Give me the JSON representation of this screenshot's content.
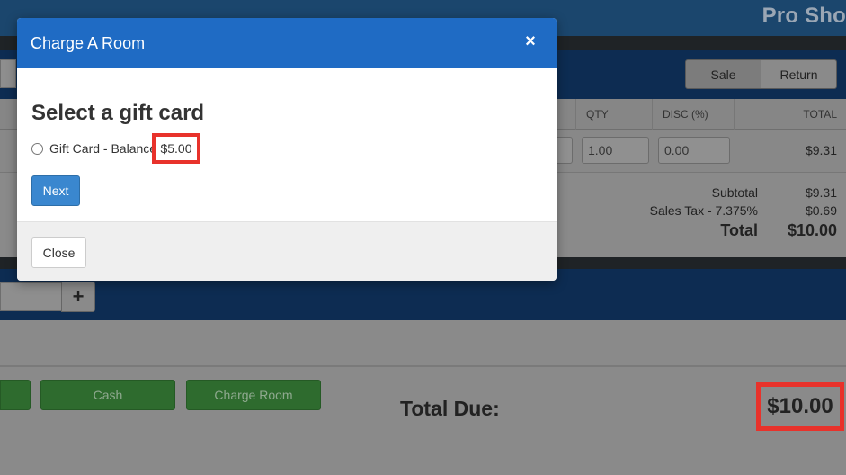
{
  "app": {
    "title": "Pro Sho"
  },
  "mode_toggle": {
    "sale_label": "Sale",
    "return_label": "Return"
  },
  "table": {
    "columns": [
      "QTY",
      "DISC (%)",
      "TOTAL"
    ],
    "rows": [
      {
        "qty": "1.00",
        "disc": "0.00",
        "total": "$9.31"
      }
    ]
  },
  "summary": {
    "subtotal_label": "Subtotal",
    "subtotal_value": "$9.31",
    "tax_label": "Sales Tax - 7.375%",
    "tax_value": "$0.69",
    "total_label": "Total",
    "total_value": "$10.00"
  },
  "add_item": {
    "plus_label": "+"
  },
  "payment": {
    "cash_label": "Cash",
    "charge_room_label": "Charge Room",
    "total_due_label": "Total Due:",
    "total_due_value": "$10.00"
  },
  "modal": {
    "title": "Charge A Room",
    "close_icon": "×",
    "heading": "Select a gift card",
    "options": [
      {
        "label": "Gift Card - Balance",
        "balance": "$5.00"
      }
    ],
    "next_label": "Next",
    "close_label": "Close"
  },
  "colors": {
    "modal_header": "#1f6bc4",
    "primary_button": "#3a87cf",
    "highlight_box": "#e8322b",
    "payment_button": "#2e6b2e"
  }
}
